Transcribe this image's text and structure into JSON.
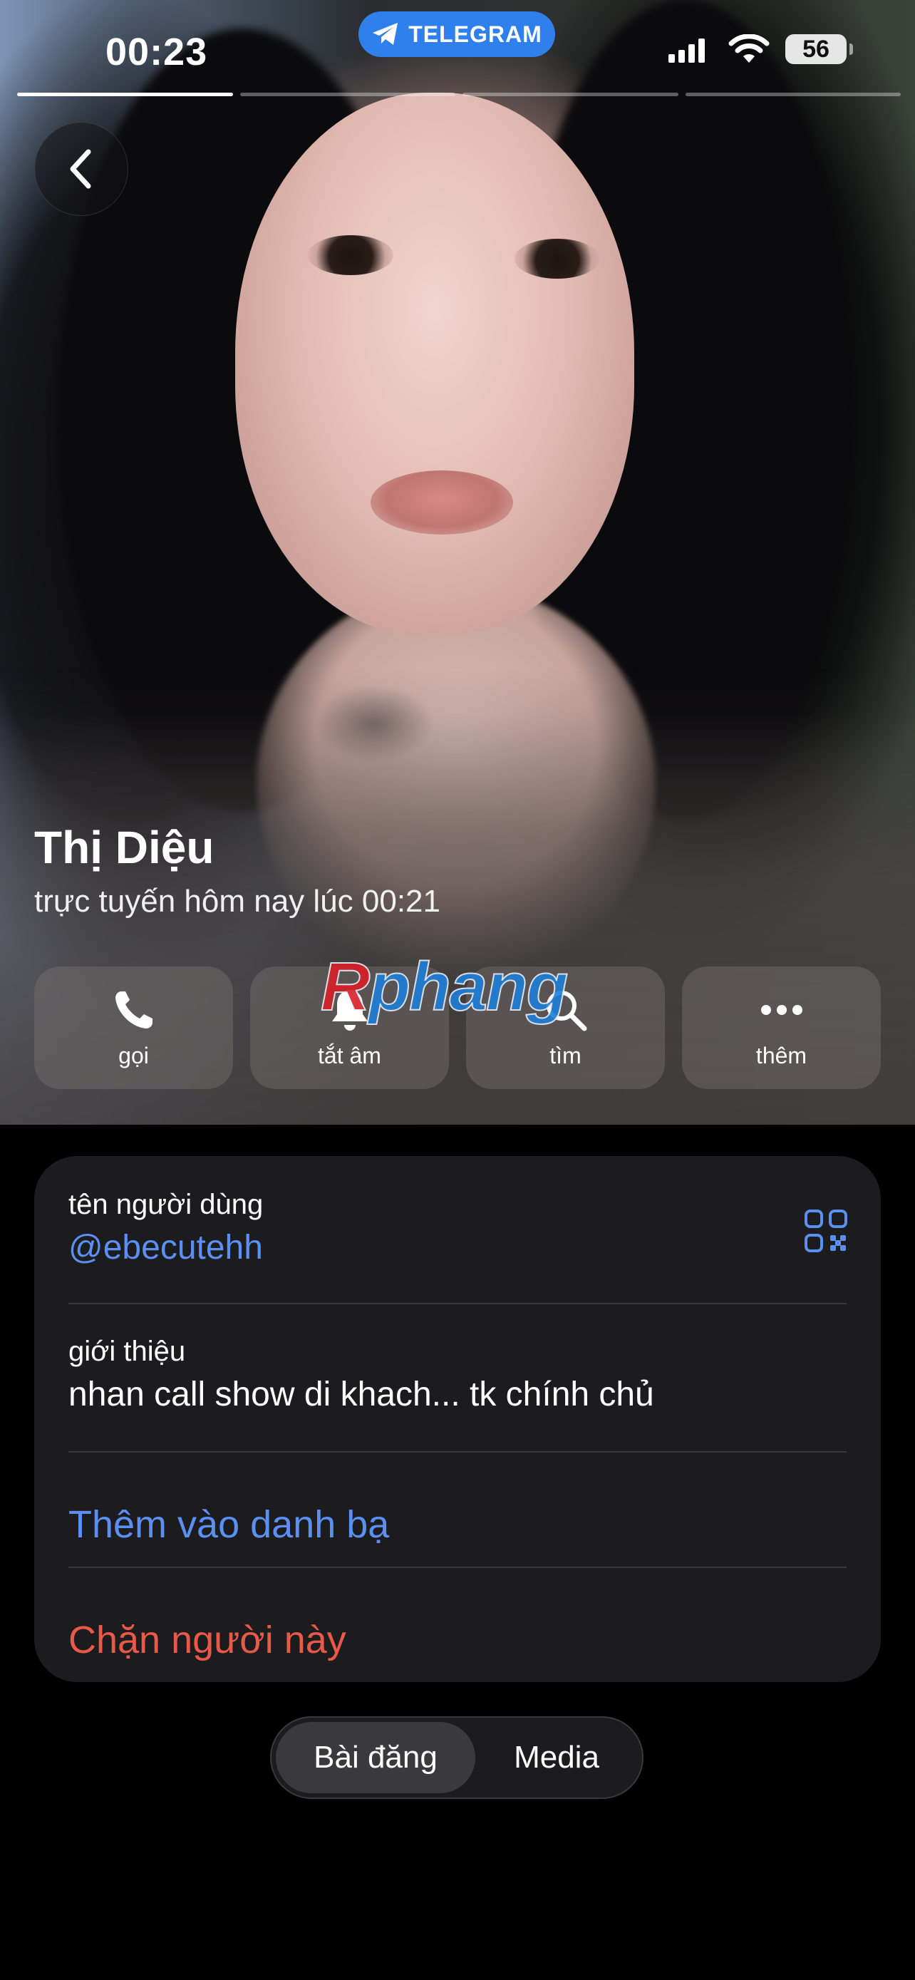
{
  "status_bar": {
    "time": "00:23",
    "app_pill": "TELEGRAM",
    "battery": "56"
  },
  "profile": {
    "name": "Thị Diệu",
    "last_seen": "trực tuyến hôm nay lúc 00:21"
  },
  "actions": [
    {
      "label": "gọi",
      "icon": "phone-icon"
    },
    {
      "label": "tắt âm",
      "icon": "bell-icon"
    },
    {
      "label": "tìm",
      "icon": "search-icon"
    },
    {
      "label": "thêm",
      "icon": "more-icon"
    }
  ],
  "watermark": {
    "first": "R",
    "rest": "phang"
  },
  "info": {
    "username_label": "tên người dùng",
    "username": "@ebecutehh",
    "bio_label": "giới thiệu",
    "bio": "nhan call show di khach... tk chính chủ",
    "add_contact": "Thêm vào danh bạ",
    "block": "Chặn người này"
  },
  "tabs": [
    "Bài đăng",
    "Media"
  ],
  "colors": {
    "accent": "#5b8ff2",
    "destructive": "#e8594a",
    "telegram": "#2f80ed",
    "card": "#1c1c1e"
  }
}
